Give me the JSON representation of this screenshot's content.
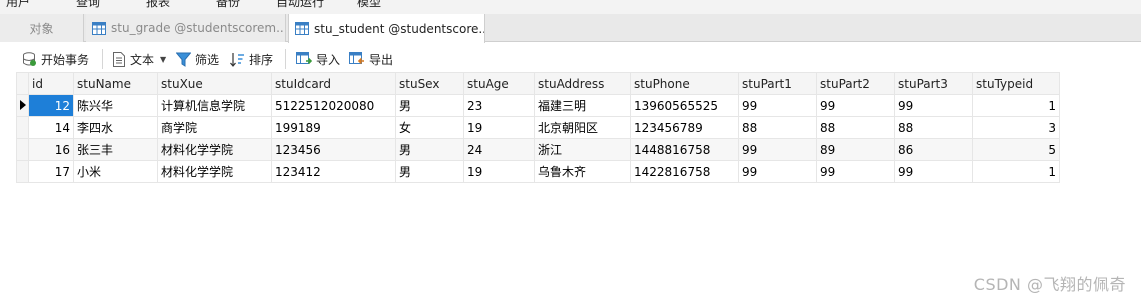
{
  "menu": [
    "用户",
    "查询",
    "报表",
    "备份",
    "自动运行",
    "模型"
  ],
  "tabs": {
    "objects": "对象",
    "grade": "stu_grade @studentscorem...",
    "student": "stu_student @studentscore..."
  },
  "toolbar": {
    "begin_tx": "开始事务",
    "text": "文本",
    "filter": "筛选",
    "sort": "排序",
    "import": "导入",
    "export": "导出"
  },
  "table": {
    "columns": [
      "id",
      "stuName",
      "stuXue",
      "stuIdcard",
      "stuSex",
      "stuAge",
      "stuAddress",
      "stuPhone",
      "stuPart1",
      "stuPart2",
      "stuPart3",
      "stuTypeid"
    ],
    "rows": [
      [
        "12",
        "陈兴华",
        "计算机信息学院",
        "5122512020080",
        "男",
        "23",
        "福建三明",
        "13960565525",
        "99",
        "99",
        "99",
        "1"
      ],
      [
        "14",
        "李四水",
        "商学院",
        "199189",
        "女",
        "19",
        "北京朝阳区",
        "123456789",
        "88",
        "88",
        "88",
        "3"
      ],
      [
        "16",
        "张三丰",
        "材料化学学院",
        "123456",
        "男",
        "24",
        "浙江",
        "1448816758",
        "99",
        "89",
        "86",
        "5"
      ],
      [
        "17",
        "小米",
        "材料化学学院",
        "123412",
        "男",
        "19",
        "乌鲁木齐",
        "1422816758",
        "99",
        "99",
        "99",
        "1"
      ]
    ]
  },
  "watermark": "CSDN @飞翔的佩奇",
  "colors": {
    "selected": "#1e7fd8",
    "tabbar": "#e9e9e9"
  }
}
